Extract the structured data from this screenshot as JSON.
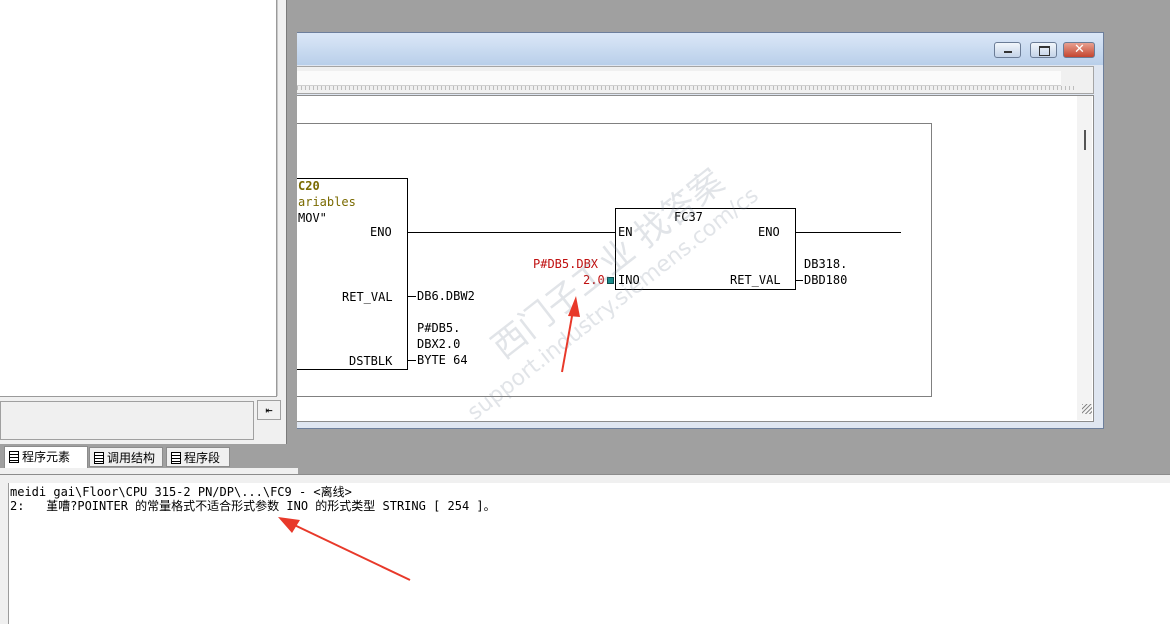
{
  "left_panel": {
    "tabs": [
      {
        "label": "程序元素",
        "active": true
      },
      {
        "label": "调用结构",
        "active": false
      },
      {
        "label": "程序段",
        "active": false
      }
    ]
  },
  "network": {
    "block1": {
      "name_partial": "C20",
      "comment_line1": "ariables",
      "comment_line2": "MOV\"",
      "eno": "ENO",
      "ret_val": "RET_VAL",
      "ret_val_operand": "DB6.DBW2",
      "dstblk": "DSTBLK",
      "dstblk_operand_l1": "P#DB5.",
      "dstblk_operand_l2": "DBX2.0",
      "dstblk_operand_l3": "BYTE 64"
    },
    "block2": {
      "name": "FC37",
      "en": "EN",
      "eno": "ENO",
      "ino": "INO",
      "ret_val": "RET_VAL",
      "ino_operand_l1": "P#DB5.DBX",
      "ino_operand_l2": "2.0",
      "ret_val_operand_l1": "DB318.",
      "ret_val_operand_l2": "DBD180"
    }
  },
  "output": {
    "line1": "meidi gai\\Floor\\CPU 315-2 PN/DP\\...\\FC9 - <离线>",
    "line2": "2:   堇嘈?POINTER 的常量格式不适合形式参数 INO 的形式类型 STRING [ 254 ]。"
  },
  "watermark": {
    "line1": "西门子工业 找答案",
    "line2": "support.industry.siemens.com/cs"
  },
  "colors": {
    "operand_red": "#c01010",
    "comment_olive": "#7a6a00",
    "arrow_red": "#e8392a",
    "connector_teal": "#1a8c8c"
  }
}
